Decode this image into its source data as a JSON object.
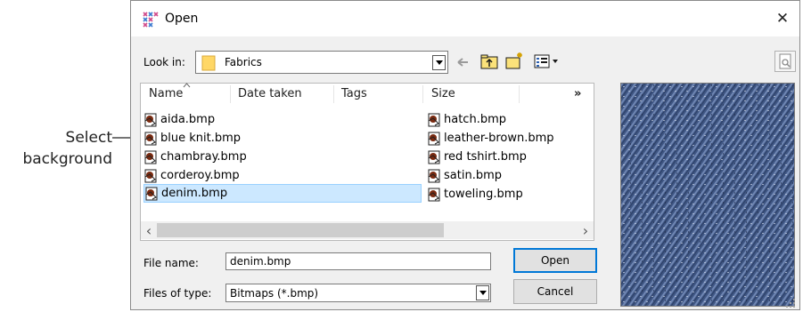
{
  "callout": {
    "line1": "Select",
    "line2": "background"
  },
  "dialog": {
    "title": "Open",
    "close_glyph": "✕",
    "look_in_label": "Look in:",
    "look_in_value": "Fabrics",
    "columns": [
      "Name",
      "Date taken",
      "Tags",
      "Size"
    ],
    "more_columns_glyph": "»",
    "files_left": [
      "aida.bmp",
      "blue knit.bmp",
      "chambray.bmp",
      "corderoy.bmp",
      "denim.bmp"
    ],
    "files_right": [
      "hatch.bmp",
      "leather-brown.bmp",
      "red tshirt.bmp",
      "satin.bmp",
      "toweling.bmp"
    ],
    "selected_file": "denim.bmp",
    "file_name_label": "File name:",
    "file_name_value": "denim.bmp",
    "files_of_type_label": "Files of type:",
    "files_of_type_value": "Bitmaps (*.bmp)",
    "open_button": "Open",
    "cancel_button": "Cancel",
    "scroll_left_glyph": "‹",
    "scroll_right_glyph": "›"
  },
  "icons": {
    "app": "cross-stitch-app-icon",
    "folder": "folder-icon",
    "back": "back-arrow-icon",
    "up": "up-folder-icon",
    "new_folder": "new-folder-icon",
    "view_menu": "view-menu-icon",
    "preview_toggle": "preview-toggle-icon",
    "file": "bitmap-file-icon"
  },
  "colors": {
    "accent": "#0078d7",
    "selection": "#cce8ff",
    "denim": "#3f5683"
  }
}
